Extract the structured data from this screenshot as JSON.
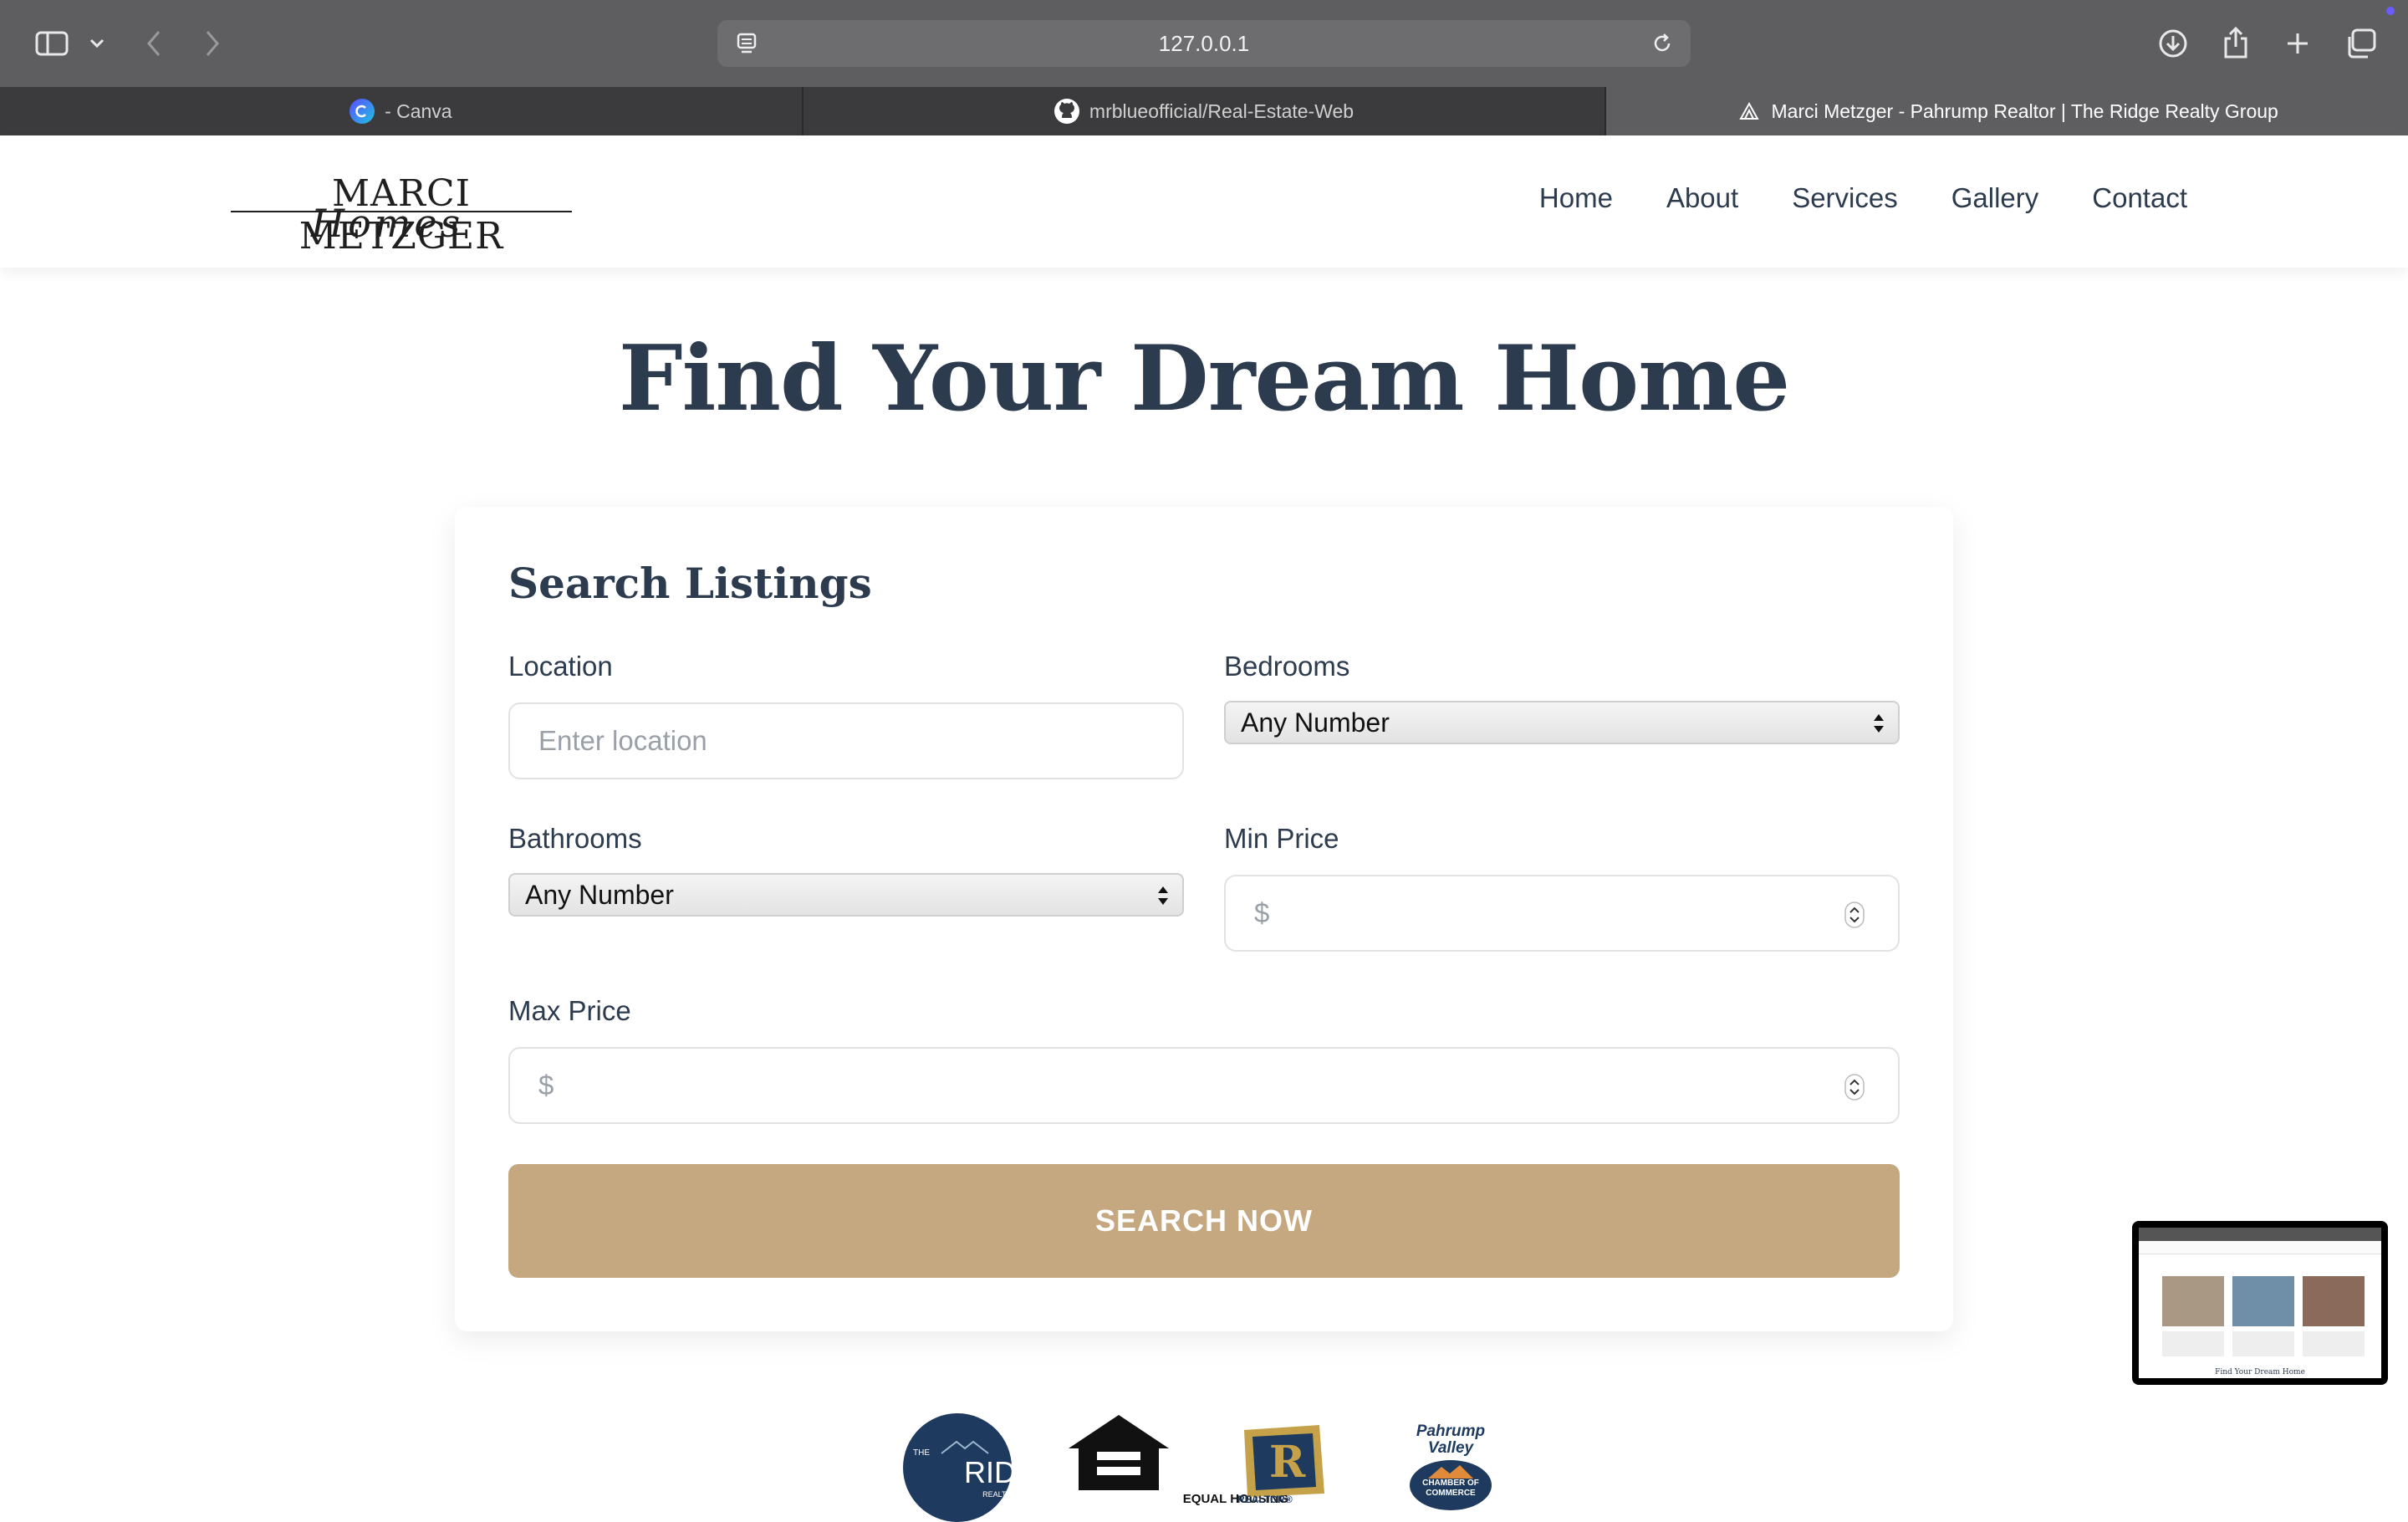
{
  "browser": {
    "url": "127.0.0.1",
    "tabs": [
      {
        "label": "- Canva",
        "active": false
      },
      {
        "label": "mrblueofficial/Real-Estate-Web",
        "active": false
      },
      {
        "label": "Marci Metzger - Pahrump Realtor | The Ridge Realty Group",
        "active": true
      }
    ]
  },
  "site": {
    "logo_main": "MARCI METZGER",
    "logo_script": "Homes",
    "nav": [
      "Home",
      "About",
      "Services",
      "Gallery",
      "Contact"
    ]
  },
  "hero": {
    "title": "Find Your Dream Home"
  },
  "search": {
    "title": "Search Listings",
    "location_label": "Location",
    "location_placeholder": "Enter location",
    "bedrooms_label": "Bedrooms",
    "bedrooms_value": "Any Number",
    "bathrooms_label": "Bathrooms",
    "bathrooms_value": "Any Number",
    "min_price_label": "Min Price",
    "min_price_placeholder": "$",
    "max_price_label": "Max Price",
    "max_price_placeholder": "$",
    "button_label": "SEARCH NOW"
  },
  "badges": {
    "ridge_top": "THE",
    "ridge_main": "RIDGE",
    "ridge_sub": "REALTY GROUP",
    "equal_housing": "EQUAL HOUSING",
    "realtor": "REALTOR®",
    "chamber_title_1": "Pahrump",
    "chamber_title_2": "Valley",
    "chamber_sub": "CHAMBER OF COMMERCE"
  },
  "thumbnail": {
    "footer_text": "Find Your Dream Home"
  },
  "colors": {
    "navy": "#2d3b4e",
    "gold": "#c5a880",
    "chrome": "#5e5e60"
  }
}
